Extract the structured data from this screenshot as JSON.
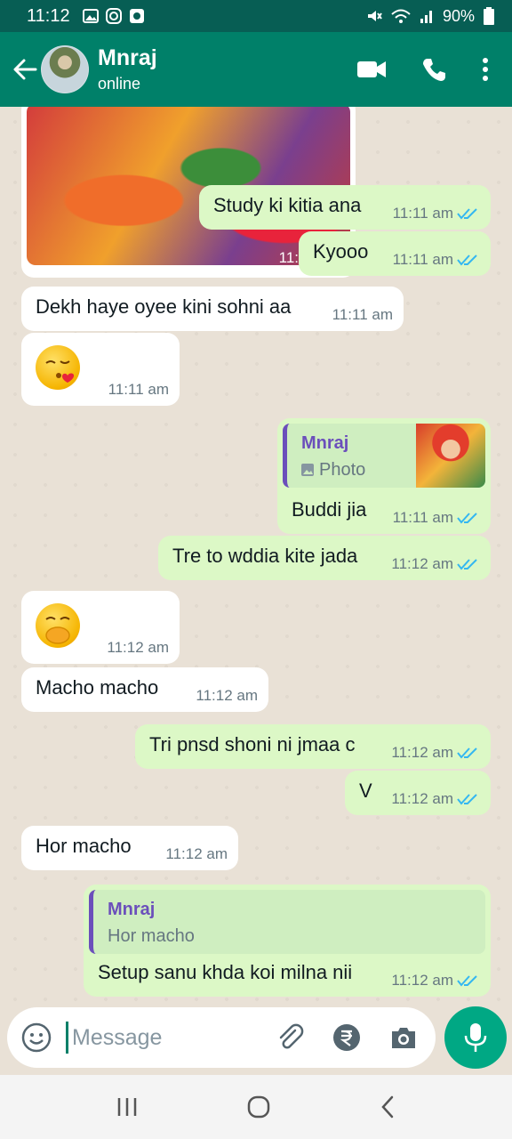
{
  "status_bar": {
    "time": "11:12",
    "battery": "90%"
  },
  "header": {
    "contact_name": "Mnraj",
    "contact_status": "online"
  },
  "messages": [
    {
      "meta": "11:11 am"
    },
    {
      "text": "Study ki kitia ana",
      "time": "11:11 am"
    },
    {
      "text": "Kyooo",
      "time": "11:11 am"
    },
    {
      "text": "Dekh haye oyee kini sohni aa",
      "time": "11:11 am"
    },
    {
      "emoji": "face-blowing-kiss",
      "time": "11:11 am"
    },
    {
      "quote_name": "Mnraj",
      "quote_sub": "Photo",
      "text": "Buddi jia",
      "time": "11:11 am"
    },
    {
      "text": "Tre to wddia kite jada",
      "time": "11:12 am"
    },
    {
      "emoji": "face-with-hand-over-mouth",
      "time": "11:12 am"
    },
    {
      "text": "Macho macho",
      "time": "11:12 am"
    },
    {
      "text": "Tri pnsd shoni ni jmaa c",
      "time": "11:12 am"
    },
    {
      "text": "V",
      "time": "11:12 am"
    },
    {
      "text": "Hor macho",
      "time": "11:12 am"
    },
    {
      "quote_name": "Mnraj",
      "quote_sub": "Hor macho",
      "text": "Setup sanu khda koi milna nii",
      "time": "11:12 am"
    }
  ],
  "input": {
    "placeholder": "Message"
  },
  "colors": {
    "header": "#008069",
    "outgoing": "#dcf8c6",
    "incoming": "#ffffff",
    "tick_read": "#34b7f1",
    "accent": "#00a884"
  }
}
